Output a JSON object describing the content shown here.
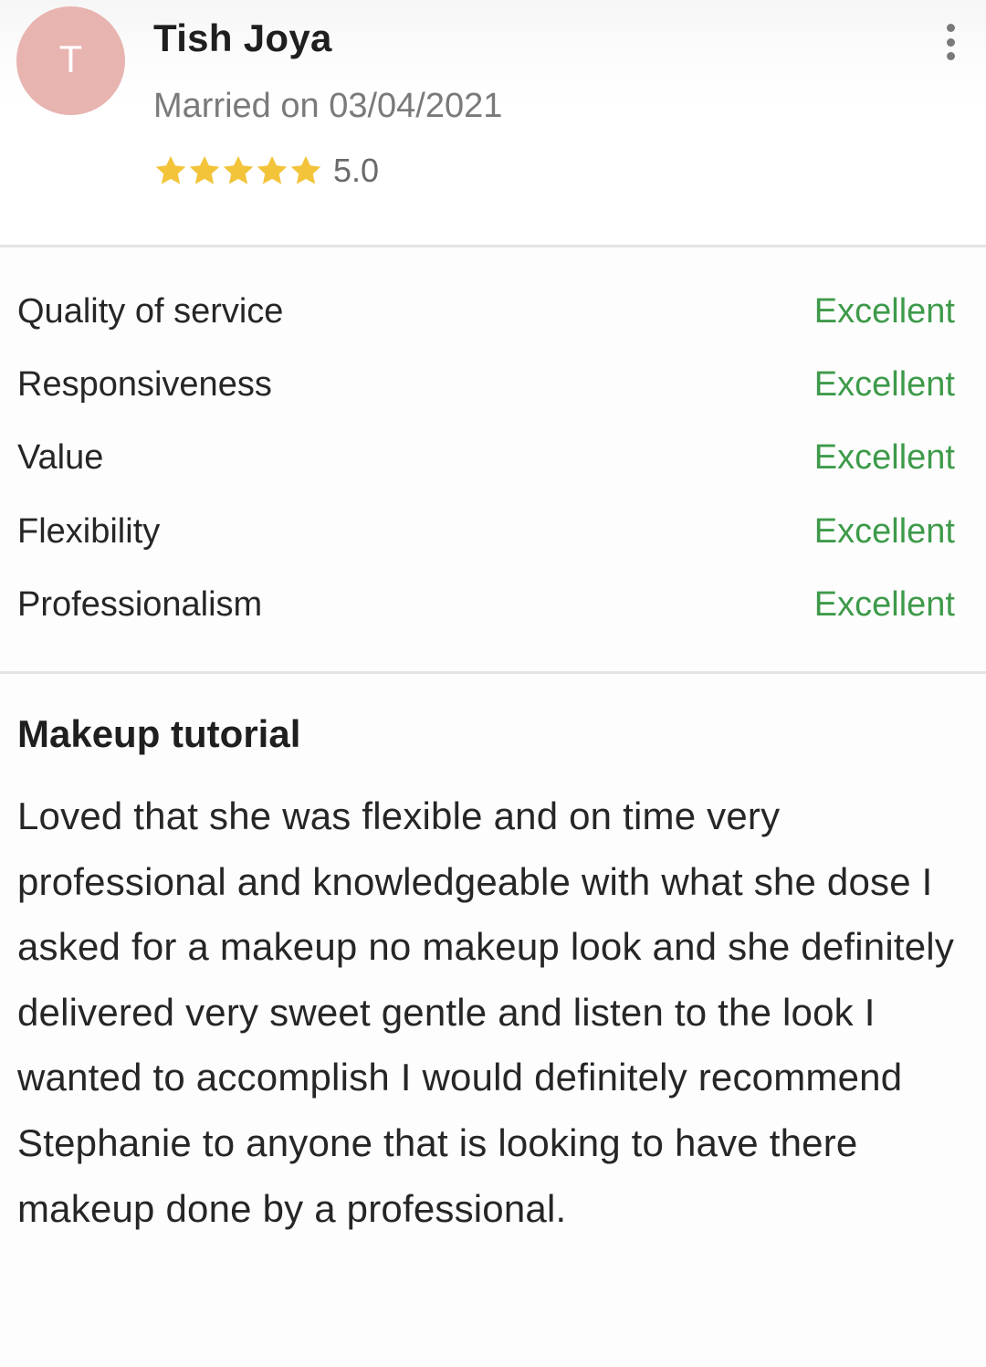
{
  "reviewer": {
    "avatar_initial": "T",
    "avatar_color": "#e8b4b0",
    "name": "Tish Joya",
    "married_line": "Married on 03/04/2021",
    "rating_value": "5.0",
    "stars": 5,
    "star_color": "#f3c43a"
  },
  "menu": {
    "icon": "more-vertical-icon"
  },
  "ratings": [
    {
      "label": "Quality of service",
      "score": "Excellent"
    },
    {
      "label": "Responsiveness",
      "score": "Excellent"
    },
    {
      "label": "Value",
      "score": "Excellent"
    },
    {
      "label": "Flexibility",
      "score": "Excellent"
    },
    {
      "label": "Professionalism",
      "score": "Excellent"
    }
  ],
  "score_color": "#3e9a4a",
  "review": {
    "title": "Makeup tutorial",
    "body": "Loved that she was flexible and on time very professional and knowledgeable with what she dose I asked for a makeup no makeup look and she definitely delivered very sweet gentle and listen to the look I wanted to accomplish I would definitely recommend Stephanie to anyone that is looking to have there makeup done by a professional."
  }
}
